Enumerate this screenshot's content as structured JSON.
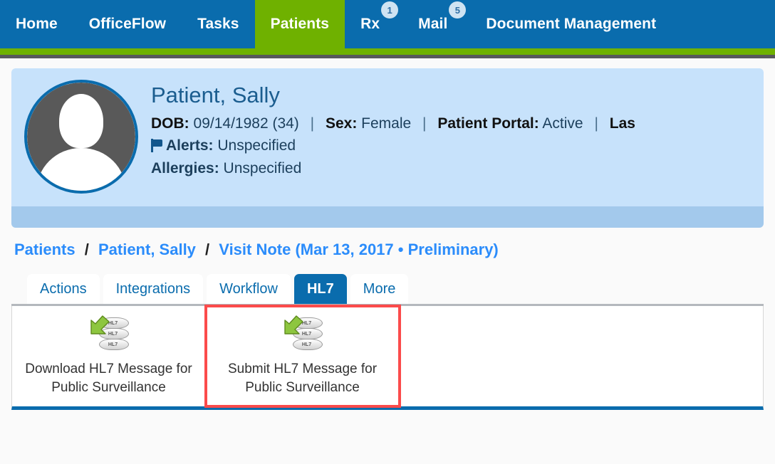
{
  "topnav": {
    "items": [
      {
        "label": "Home",
        "active": false,
        "badge": null
      },
      {
        "label": "OfficeFlow",
        "active": false,
        "badge": null
      },
      {
        "label": "Tasks",
        "active": false,
        "badge": null
      },
      {
        "label": "Patients",
        "active": true,
        "badge": null
      },
      {
        "label": "Rx",
        "active": false,
        "badge": "1"
      },
      {
        "label": "Mail",
        "active": false,
        "badge": "5"
      },
      {
        "label": "Document Management",
        "active": false,
        "badge": null
      }
    ],
    "accent_blue": "#0a6cad",
    "accent_green": "#6fb100"
  },
  "patient_header": {
    "name": "Patient, Sally",
    "dob_label": "DOB:",
    "dob_value": "09/14/1982 (34)",
    "sex_label": "Sex:",
    "sex_value": "Female",
    "portal_label": "Patient Portal:",
    "portal_value": "Active",
    "last_label": "Las",
    "alerts_label": "Alerts:",
    "alerts_value": "Unspecified",
    "allergies_label": "Allergies:",
    "allergies_value": "Unspecified",
    "separator": "|",
    "avatar_icon": "person-silhouette-icon",
    "alert_flag_icon": "flag-icon"
  },
  "breadcrumb": {
    "items": [
      "Patients",
      "Patient, Sally",
      "Visit Note (Mar 13, 2017 • Preliminary)"
    ],
    "separator": "/"
  },
  "tabs": [
    {
      "label": "Actions",
      "active": false
    },
    {
      "label": "Integrations",
      "active": false
    },
    {
      "label": "Workflow",
      "active": false
    },
    {
      "label": "HL7",
      "active": true
    },
    {
      "label": "More",
      "active": false
    }
  ],
  "hl7_panel": {
    "cards": [
      {
        "label": "Download HL7 Message for Public Surveillance",
        "icon": "hl7-database-download-icon",
        "highlighted": false
      },
      {
        "label": "Submit HL7 Message for Public Surveillance",
        "icon": "hl7-database-submit-icon",
        "highlighted": true
      }
    ],
    "highlight_color": "#fb4b4b",
    "icon_text": "HL7"
  }
}
